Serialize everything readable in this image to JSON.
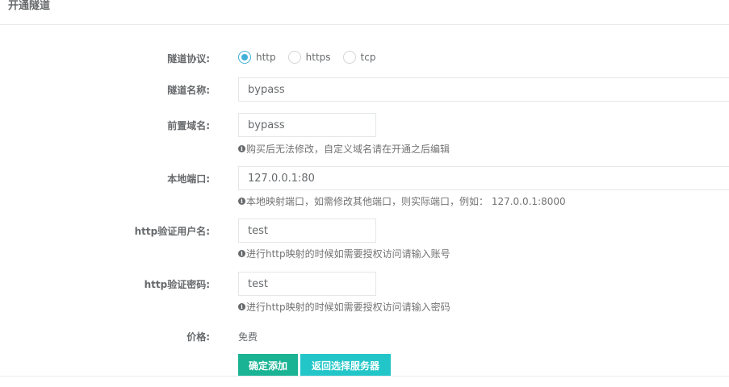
{
  "header": {
    "title": "开通隧道"
  },
  "form": {
    "protocol": {
      "label": "隧道协议:",
      "options": [
        {
          "label": "http",
          "checked": true
        },
        {
          "label": "https",
          "checked": false
        },
        {
          "label": "tcp",
          "checked": false
        }
      ]
    },
    "tunnel_name": {
      "label": "隧道名称:",
      "value": "bypass"
    },
    "prefix_domain": {
      "label": "前置域名:",
      "value": "bypass",
      "help": "购买后无法修改，自定义域名请在开通之后编辑"
    },
    "local_port": {
      "label": "本地端口:",
      "value": "127.0.0.1:80",
      "help": "本地映射端口，如需修改其他端口，则实际端口，例如： 127.0.0.1:8000"
    },
    "http_username": {
      "label": "http验证用户名:",
      "value": "test",
      "help": "进行http映射的时候如需要授权访问请输入账号"
    },
    "http_password": {
      "label": "http验证密码:",
      "value": "test",
      "help": "进行http映射的时候如需要授权访问请输入密码"
    },
    "price": {
      "label": "价格:",
      "value": "免费"
    }
  },
  "actions": {
    "confirm_label": "确定添加",
    "back_label": "返回选择服务器"
  },
  "colors": {
    "radio_accent": "#43b0d9",
    "primary": "#1ab394",
    "info": "#23c6c8"
  },
  "icons": {
    "help": "info-circle-icon"
  }
}
